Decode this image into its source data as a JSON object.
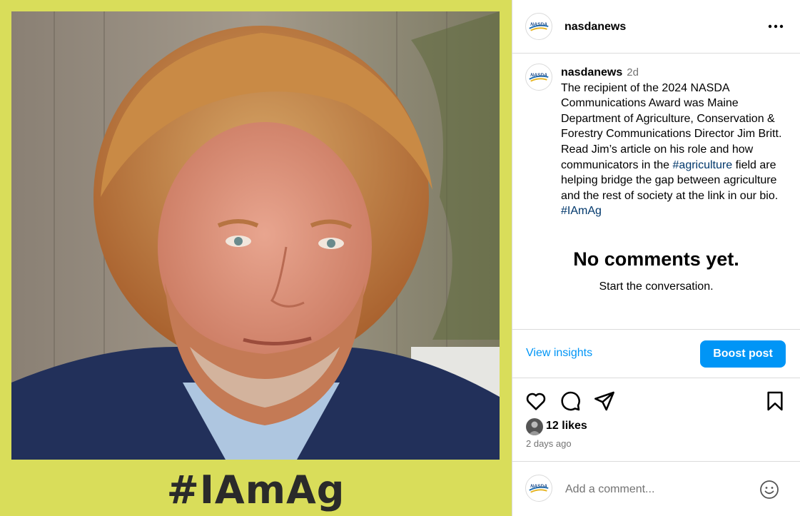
{
  "media": {
    "overlay_text": "#IAmAg",
    "colors": {
      "frame": "#d9dd5a",
      "text": "#2a2a2a"
    }
  },
  "post": {
    "username": "nasdanews",
    "logo_text": "NASDA",
    "more_icon": "more-horizontal-icon",
    "caption": {
      "username": "nasdanews",
      "time": "2d",
      "text_part1": "The recipient of the 2024 NASDA Communications Award was Maine Department of Agriculture, Conservation & Forestry Communications Director Jim Britt. Read Jim’s article on his role and how communicators in the ",
      "hashtag1": "#agriculture",
      "text_part2": " field are helping bridge the gap between agriculture and the rest of society at the link in our bio. ",
      "hashtag2": "#IAmAg"
    },
    "comments_empty": {
      "title": "No comments yet.",
      "subtitle": "Start the conversation."
    },
    "insights": {
      "view_label": "View insights",
      "boost_label": "Boost post"
    },
    "actions": {
      "like": "heart-icon",
      "comment": "comment-icon",
      "share": "send-icon",
      "save": "bookmark-icon"
    },
    "likes": "12 likes",
    "posted_ago": "2 days ago",
    "comment_box": {
      "placeholder": "Add a comment...",
      "emoji": "smiley-icon"
    },
    "colors": {
      "accent": "#0095f6",
      "hashtag": "#00376b",
      "muted": "#737373",
      "divider": "#dbdbdb"
    }
  }
}
